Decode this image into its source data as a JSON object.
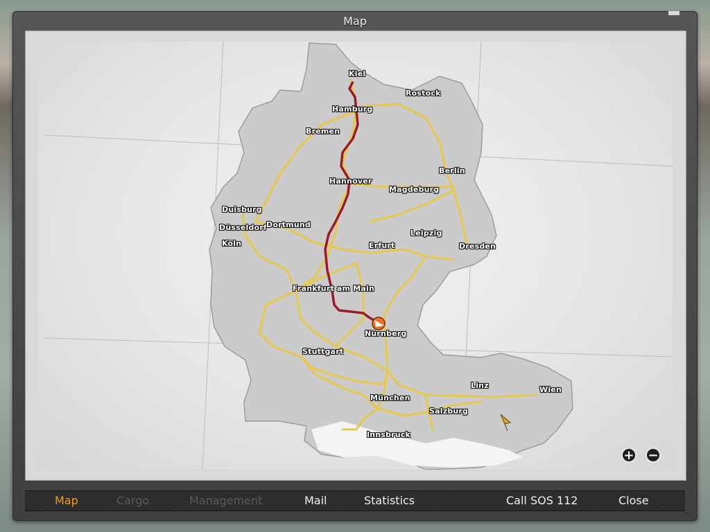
{
  "window": {
    "title": "Map"
  },
  "map": {
    "cities": [
      {
        "key": "kiel",
        "name": "Kiel"
      },
      {
        "key": "rostock",
        "name": "Rostock"
      },
      {
        "key": "hamburg",
        "name": "Hamburg"
      },
      {
        "key": "bremen",
        "name": "Bremen"
      },
      {
        "key": "berlin",
        "name": "Berlin"
      },
      {
        "key": "hannover",
        "name": "Hannover"
      },
      {
        "key": "magdeburg",
        "name": "Magdeburg"
      },
      {
        "key": "duisburg",
        "name": "Duisburg"
      },
      {
        "key": "dusseldorf",
        "name": "Düsseldorf"
      },
      {
        "key": "dortmund",
        "name": "Dortmund"
      },
      {
        "key": "koln",
        "name": "Köln"
      },
      {
        "key": "leipzig",
        "name": "Leipzig"
      },
      {
        "key": "erfurt",
        "name": "Erfurt"
      },
      {
        "key": "dresden",
        "name": "Dresden"
      },
      {
        "key": "frankfurt",
        "name": "Frankfurt am Main"
      },
      {
        "key": "nurnberg",
        "name": "Nürnberg"
      },
      {
        "key": "stuttgart",
        "name": "Stuttgart"
      },
      {
        "key": "linz",
        "name": "Linz"
      },
      {
        "key": "wien",
        "name": "Wien"
      },
      {
        "key": "munchen",
        "name": "München"
      },
      {
        "key": "salzburg",
        "name": "Salzburg"
      },
      {
        "key": "innsbruck",
        "name": "Innsbruck"
      }
    ],
    "zoom_in": "+",
    "zoom_out": "−",
    "colors": {
      "route": "#9a1a2a",
      "road": "#e8c84a",
      "land": "#c8c8c8",
      "player": "#f07020"
    }
  },
  "menu": {
    "map": "Map",
    "cargo": "Cargo",
    "management": "Management",
    "mail": "Mail",
    "statistics": "Statistics",
    "sos": "Call SOS 112",
    "close": "Close"
  }
}
